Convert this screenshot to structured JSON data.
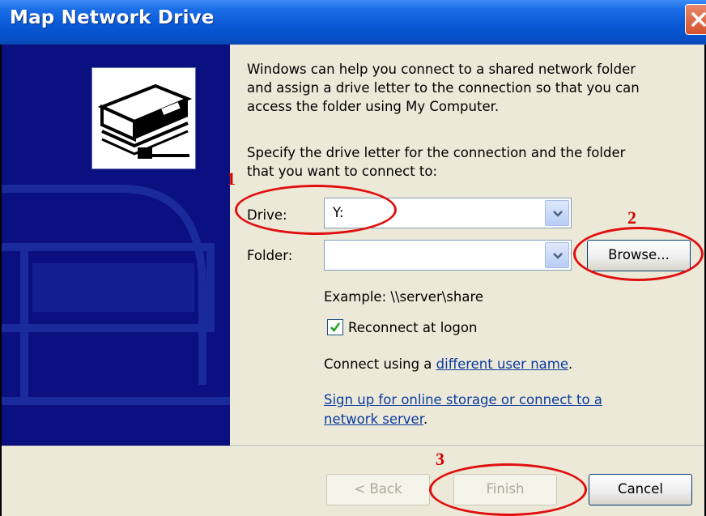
{
  "window": {
    "title": "Map Network Drive"
  },
  "intro": {
    "line1": "Windows can help you connect to a shared network folder",
    "line2": "and assign a drive letter to the connection so that you can",
    "line3": "access the folder using My Computer."
  },
  "instructions": {
    "line1": "Specify the drive letter for the connection and the folder",
    "line2": "that you want to connect to:"
  },
  "drive": {
    "label": "Drive:",
    "value": "Y:"
  },
  "folder": {
    "label": "Folder:",
    "value": ""
  },
  "browse_label": "Browse...",
  "example": "Example: \\\\server\\share",
  "reconnect": {
    "label": "Reconnect at logon",
    "checked": true
  },
  "connect": {
    "prefix": "Connect using a ",
    "link": "different user name",
    "suffix": "."
  },
  "signup": {
    "line1": "Sign up for online storage or connect to a",
    "line2": "network server",
    "suffix": "."
  },
  "buttons": {
    "back": "< Back",
    "finish": "Finish",
    "cancel": "Cancel"
  },
  "annotations": {
    "one": "1",
    "two": "2",
    "three": "3"
  },
  "colors": {
    "annotation": "#e01010",
    "title_bar": "#0a58d6",
    "left_panel": "#0a1080",
    "dialog_bg": "#ece9d8"
  },
  "icons": [
    "close-icon",
    "network-drive-icon",
    "dropdown-arrow-icon",
    "checkmark-icon"
  ]
}
